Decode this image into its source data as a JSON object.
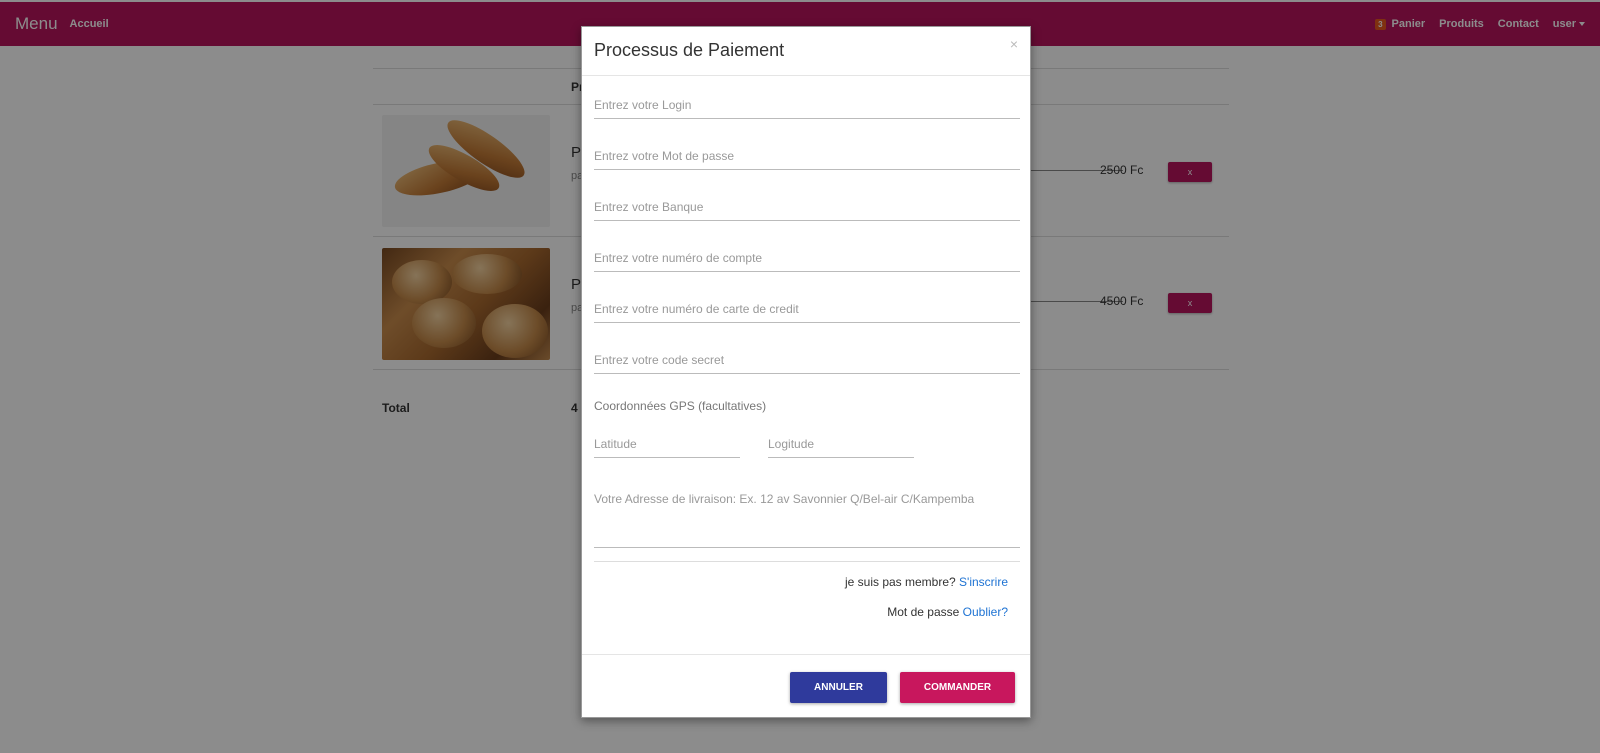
{
  "navbar": {
    "brand": "Menu",
    "home": "Accueil",
    "cart_count": "3",
    "cart": "Panier",
    "products": "Produits",
    "contact": "Contact",
    "user": "user"
  },
  "cart_table": {
    "header_product": "Pr",
    "items": [
      {
        "name": "P",
        "desc": "pa",
        "price": "2500 Fc",
        "remove": "x"
      },
      {
        "name": "P",
        "desc": "pa",
        "price": "4500 Fc",
        "remove": "x"
      }
    ],
    "total_label": "Total",
    "total_value": "4"
  },
  "modal": {
    "title": "Processus de Paiement",
    "close": "×",
    "fields": {
      "login": "Entrez votre Login",
      "password": "Entrez votre Mot de passe",
      "bank": "Entrez votre Banque",
      "account": "Entrez votre numéro de compte",
      "card": "Entrez votre numéro de carte de credit",
      "code": "Entrez votre code secret"
    },
    "gps_label": "Coordonnées GPS (facultatives)",
    "latitude": "Latitude",
    "longitude": "Logitude",
    "address": "Votre Adresse de livraison: Ex. 12 av Savonnier Q/Bel-air C/Kampemba",
    "not_member": "je suis pas membre?",
    "signup": "S'inscrire",
    "password_text": "Mot de passe",
    "forgot": "Oublier?",
    "cancel": "ANNULER",
    "order": "COMMANDER"
  },
  "colors": {
    "navbar": "#b8155e",
    "cancel_button": "#2f3a9c",
    "order_button": "#c8175d",
    "link": "#1e73d3"
  }
}
